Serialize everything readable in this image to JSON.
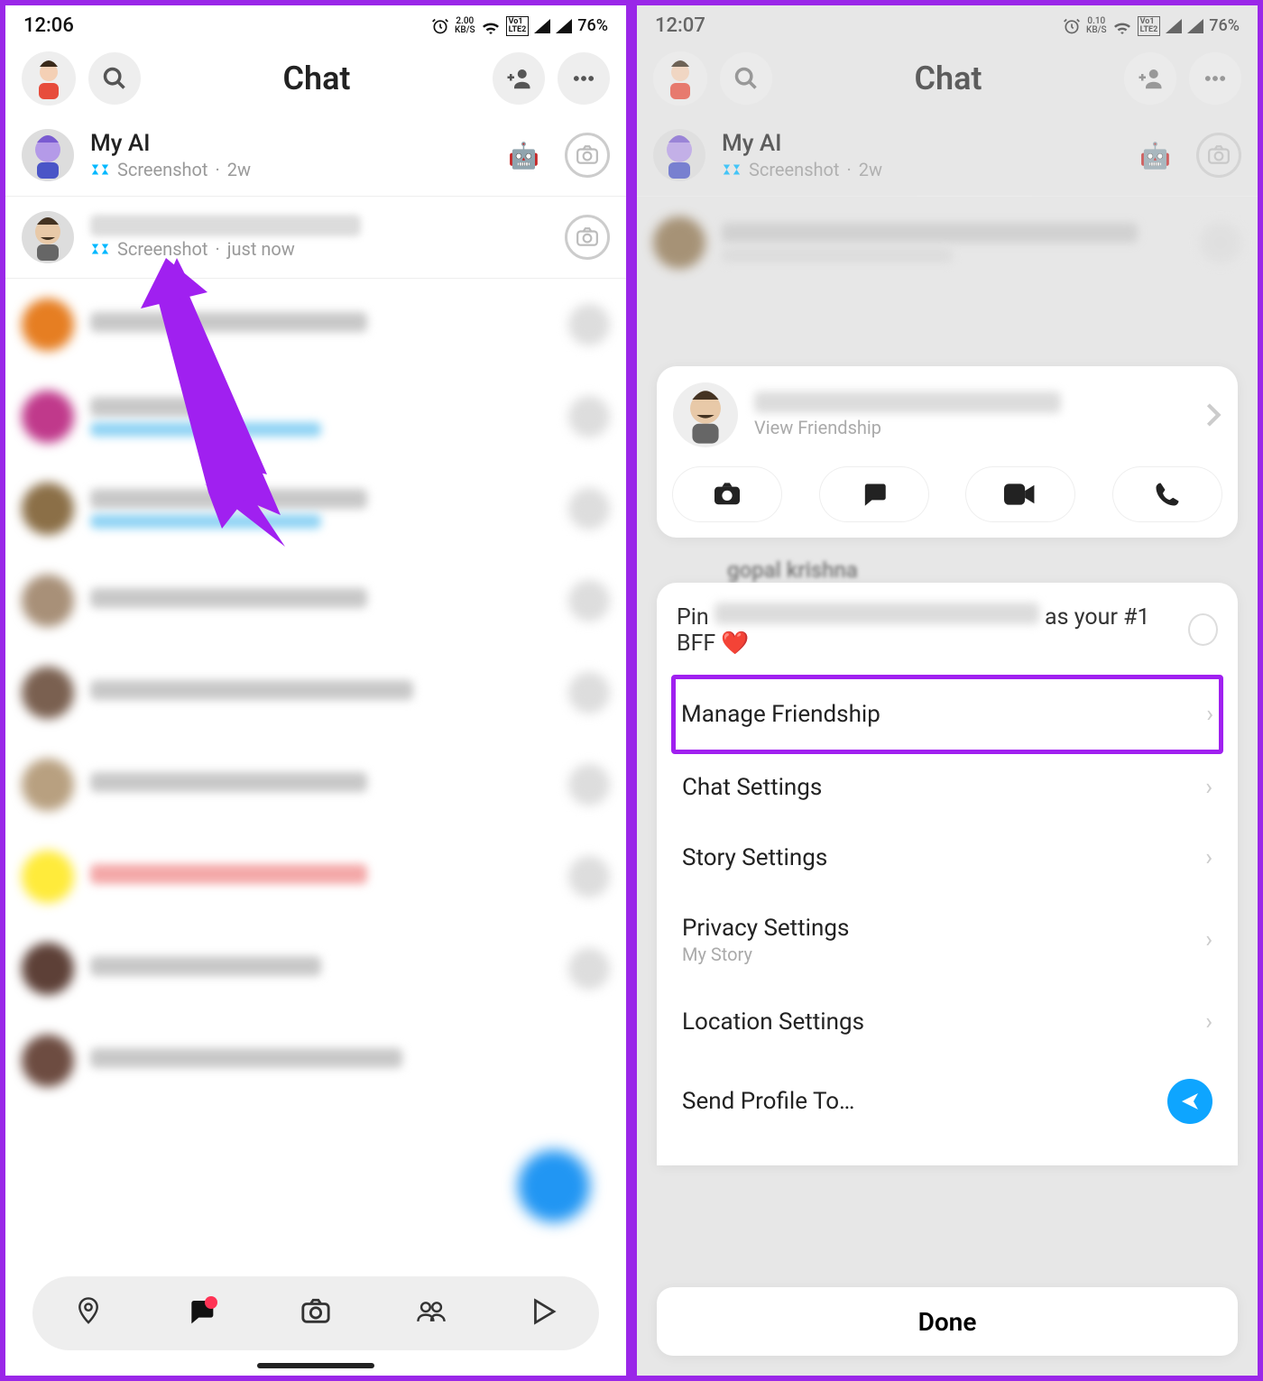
{
  "status_left": {
    "time": "12:06",
    "alarm": "⏰",
    "speed": "2.00\nKB/S",
    "wifi": "▾",
    "lte": "VoLTE2",
    "sig": "◢◢",
    "batt": "76%"
  },
  "status_right_panel": {
    "time": "12:07",
    "alarm": "⏰",
    "speed": "0.10\nKB/S",
    "wifi": "▾",
    "lte": "VoLTE2",
    "sig": "◢◢",
    "batt": "76%"
  },
  "header": {
    "title": "Chat"
  },
  "chats": {
    "myai": {
      "name": "My AI",
      "status": "Screenshot",
      "time": "2w"
    },
    "friend": {
      "status": "Screenshot",
      "time": "just now"
    }
  },
  "profile_card": {
    "view": "View Friendship"
  },
  "pin": {
    "prefix": "Pin ",
    "suffix": " as your #1 BFF ❤️"
  },
  "menu": {
    "manage": "Manage Friendship",
    "chat": "Chat Settings",
    "story": "Story Settings",
    "privacy": "Privacy Settings",
    "privacy_sub": "My Story",
    "location": "Location Settings",
    "send": "Send Profile To…"
  },
  "done": "Done",
  "hidden_row": "gopal krishna"
}
